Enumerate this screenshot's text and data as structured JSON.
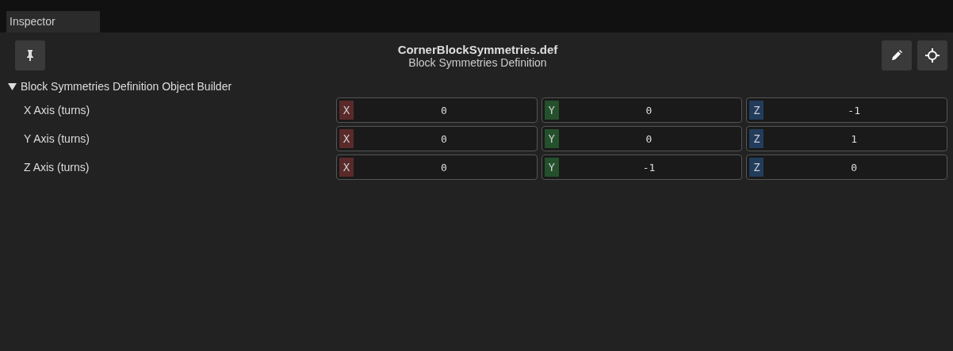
{
  "panel_tab": {
    "label": "Inspector"
  },
  "header": {
    "title": "CornerBlockSymmetries.def",
    "subtitle": "Block Symmetries Definition"
  },
  "section": {
    "label": "Block Symmetries Definition Object Builder",
    "expanded": true,
    "rows": [
      {
        "label": "X Axis (turns)",
        "components": [
          {
            "axis": "X",
            "color": "#5a2a2a",
            "value": "0"
          },
          {
            "axis": "Y",
            "color": "#24502c",
            "value": "0"
          },
          {
            "axis": "Z",
            "color": "#223c5c",
            "value": "-1"
          }
        ]
      },
      {
        "label": "Y Axis (turns)",
        "components": [
          {
            "axis": "X",
            "color": "#5a2a2a",
            "value": "0"
          },
          {
            "axis": "Y",
            "color": "#24502c",
            "value": "0"
          },
          {
            "axis": "Z",
            "color": "#223c5c",
            "value": "1"
          }
        ]
      },
      {
        "label": "Z Axis (turns)",
        "components": [
          {
            "axis": "X",
            "color": "#5a2a2a",
            "value": "0"
          },
          {
            "axis": "Y",
            "color": "#24502c",
            "value": "-1"
          },
          {
            "axis": "Z",
            "color": "#223c5c",
            "value": "0"
          }
        ]
      }
    ]
  }
}
